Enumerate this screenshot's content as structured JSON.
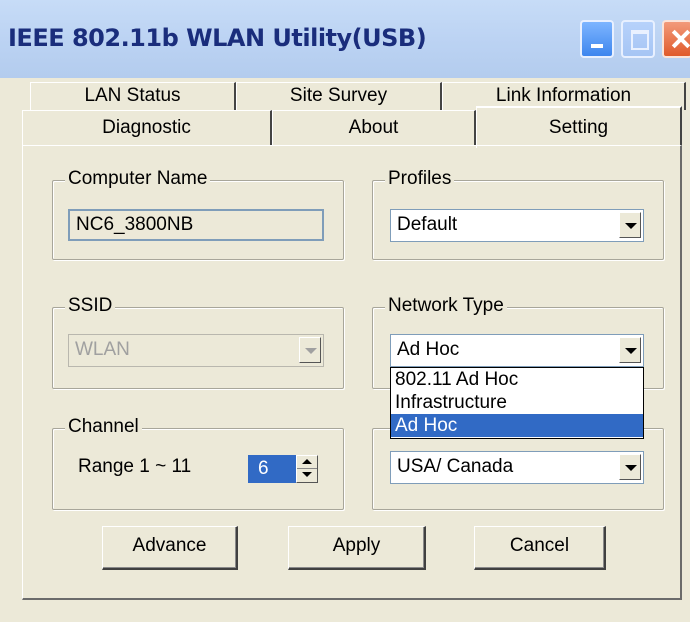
{
  "window": {
    "title": "IEEE 802.11b WLAN Utility(USB)"
  },
  "tabs": {
    "row1": [
      "LAN Status",
      "Site Survey",
      "Link Information"
    ],
    "row2": [
      "Diagnostic",
      "About",
      "Setting"
    ],
    "active": "Setting"
  },
  "computer_name": {
    "legend": "Computer Name",
    "value": "NC6_3800NB"
  },
  "profiles": {
    "legend": "Profiles",
    "selected": "Default"
  },
  "ssid": {
    "legend": "SSID",
    "selected": "WLAN",
    "enabled": false
  },
  "network_type": {
    "legend": "Network Type",
    "selected": "Ad Hoc",
    "options": [
      "802.11 Ad Hoc",
      "Infrastructure",
      "Ad Hoc"
    ],
    "highlighted_option": "Ad Hoc"
  },
  "channel": {
    "legend": "Channel",
    "range_label": "Range 1 ~ 11",
    "value": "6"
  },
  "country": {
    "selected": "USA/ Canada"
  },
  "buttons": {
    "advance": "Advance",
    "apply": "Apply",
    "cancel": "Cancel"
  },
  "colors": {
    "title_text": "#1a2d7c",
    "selection": "#316ac5",
    "face": "#ece9d8"
  },
  "icons": {
    "minimize": "minimize-icon",
    "maximize": "maximize-icon",
    "close": "close-icon"
  }
}
